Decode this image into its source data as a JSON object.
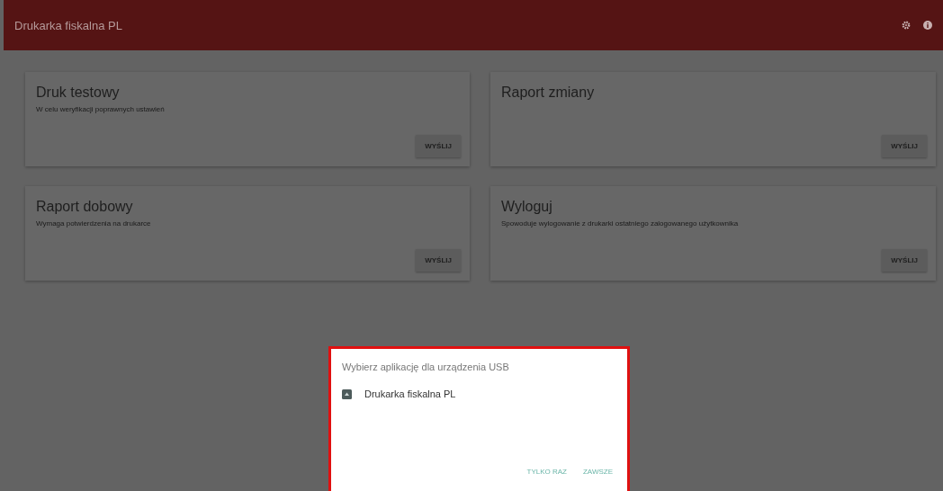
{
  "app_bar": {
    "title": "Drukarka fiskalna PL"
  },
  "cards": [
    {
      "title": "Druk testowy",
      "description": "W celu weryfikacji poprawnych ustawień",
      "button": "WYŚLIJ"
    },
    {
      "title": "Raport zmiany",
      "button": "WYŚLIJ"
    },
    {
      "title": "Raport dobowy",
      "description": "Wymaga potwierdzenia na drukarce",
      "button": "WYŚLIJ"
    },
    {
      "title": "Wyloguj",
      "description": "Spowoduje wylogowanie z drukarki ostatniego zalogowanego użytkownika",
      "button": "WYŚLIJ"
    }
  ],
  "dialog": {
    "title": "Wybierz aplikację dla urządzenia USB",
    "app": {
      "label": "Drukarka fiskalna PL"
    },
    "buttons": [
      "TYLKO RAZ",
      "ZAWSZE"
    ]
  }
}
